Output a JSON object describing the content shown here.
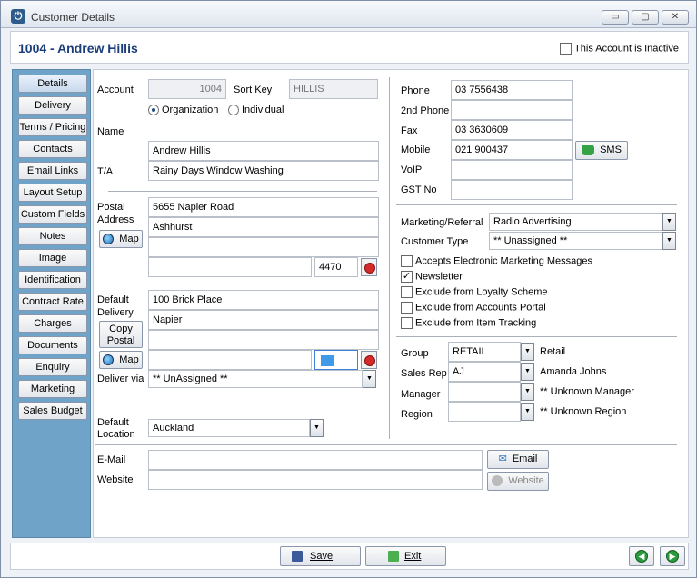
{
  "window": {
    "title": "Customer Details",
    "minimize": "▭",
    "maximize": "▢",
    "close": "✕"
  },
  "header": {
    "account_title": "1004 - Andrew Hillis",
    "inactive_label": "This Account is Inactive"
  },
  "sidebar": {
    "items": [
      "Details",
      "Delivery",
      "Terms / Pricing",
      "Contacts",
      "Email Links",
      "Layout Setup",
      "Custom Fields",
      "Notes",
      "Image",
      "Identification",
      "Contract Rate",
      "Charges",
      "Documents",
      "Enquiry",
      "Marketing",
      "Sales Budget"
    ]
  },
  "details": {
    "account_label": "Account",
    "account_value": "1004",
    "sortkey_label": "Sort Key",
    "sortkey_value": "HILLIS",
    "org_label": "Organization",
    "ind_label": "Individual",
    "name_label": "Name",
    "name_value": "Andrew Hillis",
    "ta_label": "T/A",
    "ta_value": "Rainy Days Window Washing",
    "postal_label1": "Postal",
    "postal_label2": "Address",
    "postal_line1": "5655 Napier Road",
    "postal_line2": "Ashhurst",
    "postal_code": "4470",
    "map_label": "Map",
    "delivery_label1": "Default",
    "delivery_label2": "Delivery",
    "delivery_line1": "100 Brick Place",
    "delivery_line2": "Napier",
    "copy_label1": "Copy",
    "copy_label2": "Postal",
    "deliver_via_label": "Deliver via",
    "deliver_via_value": "** UnAssigned **",
    "location_label1": "Default",
    "location_label2": "Location",
    "location_value": "Auckland",
    "email_label": "E-Mail",
    "email_btn": "Email",
    "website_label": "Website",
    "website_btn": "Website"
  },
  "phones": {
    "phone_label": "Phone",
    "phone_value": "03 7556438",
    "phone2_label": "2nd Phone",
    "phone2_value": "",
    "fax_label": "Fax",
    "fax_value": "03 3630609",
    "mobile_label": "Mobile",
    "mobile_value": "021 900437",
    "voip_label": "VoIP",
    "gst_label": "GST No",
    "sms_btn": "SMS"
  },
  "marketing": {
    "referral_label": "Marketing/Referral",
    "referral_value": "Radio Advertising",
    "custtype_label": "Customer Type",
    "custtype_value": "** Unassigned **",
    "checks": [
      {
        "label": "Accepts Electronic Marketing Messages",
        "checked": false
      },
      {
        "label": "Newsletter",
        "checked": true
      },
      {
        "label": "Exclude from Loyalty Scheme",
        "checked": false
      },
      {
        "label": "Exclude from Accounts Portal",
        "checked": false
      },
      {
        "label": "Exclude from Item Tracking",
        "checked": false
      }
    ]
  },
  "groups": {
    "group_label": "Group",
    "group_value": "RETAIL",
    "group_desc": "Retail",
    "salesrep_label": "Sales Rep",
    "salesrep_value": "AJ",
    "salesrep_desc": "Amanda Johns",
    "manager_label": "Manager",
    "manager_desc": "** Unknown Manager",
    "region_label": "Region",
    "region_desc": "** Unknown Region"
  },
  "footer": {
    "save": "Save",
    "exit": "Exit"
  }
}
